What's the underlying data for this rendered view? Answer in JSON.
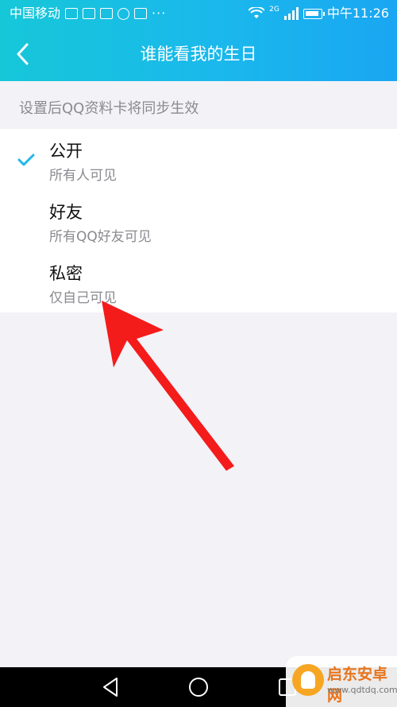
{
  "status_bar": {
    "carrier": "中国移动",
    "signal_label": "2G",
    "time": "中午11:26",
    "dots": "···"
  },
  "header": {
    "title": "谁能看我的生日"
  },
  "hint": "设置后QQ资料卡将同步生效",
  "options": [
    {
      "label": "公开",
      "sub": "所有人可见",
      "selected": true
    },
    {
      "label": "好友",
      "sub": "所有QQ好友可见",
      "selected": false
    },
    {
      "label": "私密",
      "sub": "仅自己可见",
      "selected": false
    }
  ],
  "watermark": {
    "name": "启东安卓网",
    "url": "www.qdtdq.com"
  },
  "colors": {
    "accent": "#1fb7e8",
    "check": "#1fb7e8",
    "arrow": "#f41b1b"
  }
}
